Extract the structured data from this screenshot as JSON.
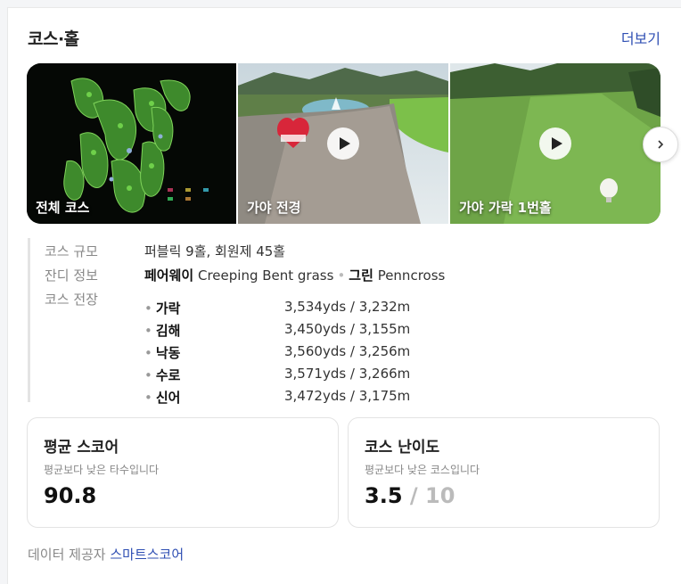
{
  "header": {
    "title": "코스·홀",
    "more_label": "더보기"
  },
  "gallery": [
    {
      "label": "전체 코스",
      "video": false
    },
    {
      "label": "가야 전경",
      "video": true
    },
    {
      "label": "가야 가락 1번홀",
      "video": true
    }
  ],
  "info": {
    "scale_label": "코스 규모",
    "scale_value": "퍼블릭 9홀, 회원제 45홀",
    "grass_label": "잔디 정보",
    "fairway_label": "페어웨이",
    "fairway_value": "Creeping Bent grass",
    "green_label": "그린",
    "green_value": "Penncross",
    "length_label": "코스 전장",
    "courses": [
      {
        "name": "가락",
        "length": "3,534yds / 3,232m"
      },
      {
        "name": "김해",
        "length": "3,450yds / 3,155m"
      },
      {
        "name": "낙동",
        "length": "3,560yds / 3,256m"
      },
      {
        "name": "수로",
        "length": "3,571yds / 3,266m"
      },
      {
        "name": "신어",
        "length": "3,472yds / 3,175m"
      }
    ]
  },
  "stats": {
    "avg_title": "평균 스코어",
    "avg_sub": "평균보다 낮은 타수입니다",
    "avg_value": "90.8",
    "diff_title": "코스 난이도",
    "diff_sub": "평균보다 낮은 코스입니다",
    "diff_value": "3.5",
    "diff_max": "/ 10"
  },
  "footer": {
    "label": "데이터 제공자",
    "provider": "스마트스코어"
  },
  "colors": {
    "link": "#2f4fb3",
    "muted": "#888888",
    "border": "#e3e3e3"
  }
}
